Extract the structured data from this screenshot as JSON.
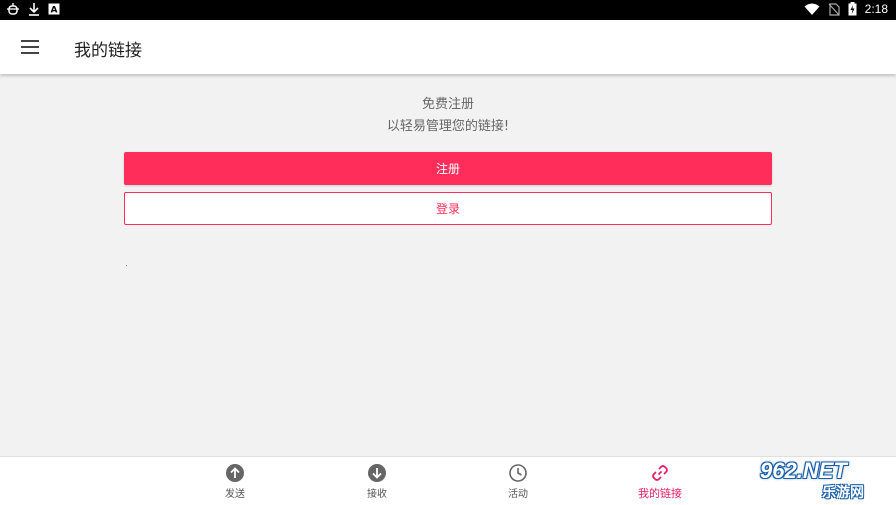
{
  "status_bar": {
    "time": "2:18",
    "left_icons": [
      "bug-icon",
      "download-icon",
      "a-icon"
    ],
    "right_icons": [
      "wifi-icon",
      "no-sim-icon",
      "battery-icon"
    ]
  },
  "app_bar": {
    "title": "我的链接",
    "menu_icon": "menu-icon"
  },
  "intro": {
    "line1": "免费注册",
    "line2": "以轻易管理您的链接!"
  },
  "buttons": {
    "register_label": "注册",
    "login_label": "登录"
  },
  "bottom_nav": {
    "items": [
      {
        "label": "发送",
        "icon": "upload-icon",
        "active": false
      },
      {
        "label": "接收",
        "icon": "download-icon",
        "active": false
      },
      {
        "label": "活动",
        "icon": "clock-icon",
        "active": false
      },
      {
        "label": "我的链接",
        "icon": "link-icon",
        "active": true
      }
    ]
  },
  "watermark": {
    "main": "962.NET",
    "sub": "乐游网"
  },
  "colors": {
    "accent": "#ff2d5a",
    "active_nav": "#e91e63"
  }
}
